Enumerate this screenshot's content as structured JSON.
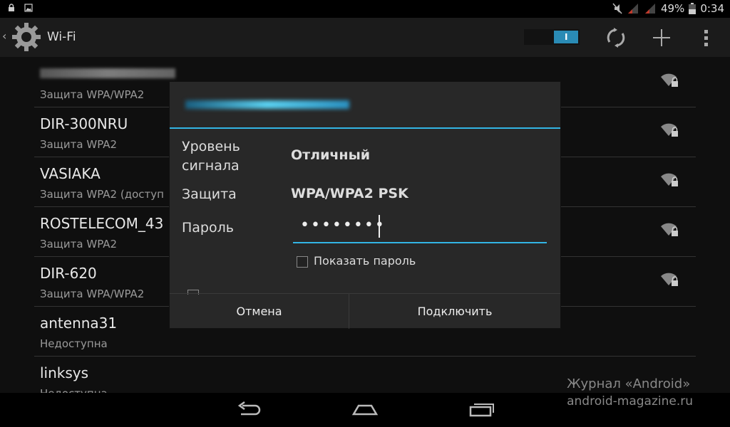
{
  "status_bar": {
    "battery": "49%",
    "time": "0:34"
  },
  "action_bar": {
    "title": "Wi-Fi",
    "toggle_label": "I",
    "icons": [
      "settings-icon",
      "scan-icon",
      "add-icon",
      "overflow-icon"
    ]
  },
  "networks": [
    {
      "ssid": "",
      "security": "Защита WPA/WPA2"
    },
    {
      "ssid": "DIR-300NRU",
      "security": "Защита WPA2"
    },
    {
      "ssid": "VASIAKA",
      "security": "Защита WPA2 (доступ"
    },
    {
      "ssid": "ROSTELECOM_43",
      "security": "Защита WPA2"
    },
    {
      "ssid": "DIR-620",
      "security": "Защита WPA/WPA2"
    },
    {
      "ssid": "antenna31",
      "security": "Недоступна"
    },
    {
      "ssid": "linksys",
      "security": "Недоступна"
    }
  ],
  "dialog": {
    "signal_label": "Уровень сигнала",
    "signal_value": "Отличный",
    "security_label": "Защита",
    "security_value": "WPA/WPA2 PSK",
    "password_label": "Пароль",
    "password_value": "••••••••",
    "show_password_label": "Показать пароль",
    "cancel_label": "Отмена",
    "connect_label": "Подключить"
  },
  "watermark": {
    "line1": "Журнал «Android»",
    "line2": "android-magazine.ru"
  },
  "colors": {
    "accent": "#33b5e5",
    "dialog_bg": "#282828",
    "list_bg": "#0f0f0f"
  }
}
